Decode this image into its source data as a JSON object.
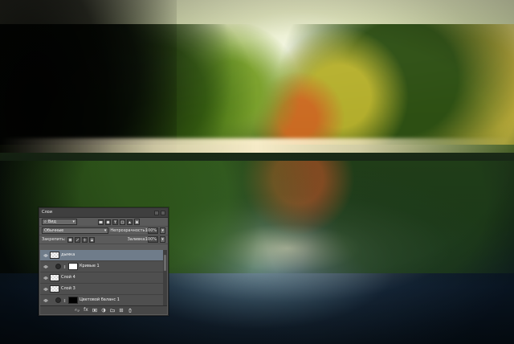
{
  "panel": {
    "title": "Слои",
    "filter": {
      "label": "Вид"
    },
    "blend_mode": {
      "value": "Обычные"
    },
    "opacity": {
      "label": "Непрозрачность:",
      "value": "100%"
    },
    "lock": {
      "label": "Закрепить:"
    },
    "fill": {
      "label": "Заливка:",
      "value": "100%"
    },
    "layers": [
      {
        "name": "дымка",
        "kind": "raster",
        "selected": true
      },
      {
        "name": "Кривые 1",
        "kind": "adjustment"
      },
      {
        "name": "Слой 4",
        "kind": "raster"
      },
      {
        "name": "Слой 3",
        "kind": "raster"
      },
      {
        "name": "Цветовой баланс 1",
        "kind": "adjustment"
      }
    ],
    "bottom": {
      "fx_label": "fx"
    }
  }
}
